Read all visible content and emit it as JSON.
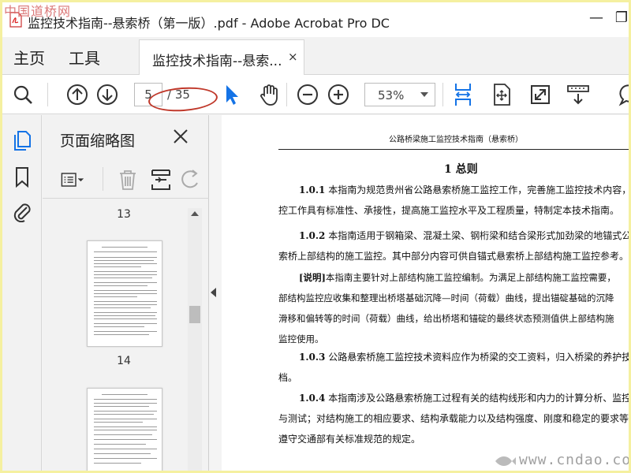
{
  "window": {
    "title": "监控技术指南--悬索桥（第一版）.pdf - Adobe Acrobat Pro DC",
    "watermark_logo": "中国道桥网",
    "minimize_glyph": "—",
    "restore_glyph": "❐"
  },
  "menu": {
    "home": "主页",
    "tools": "工具",
    "doc_tab": "监控技术指南--悬索...",
    "doc_tab_close": "×"
  },
  "toolbar": {
    "page_current": "5",
    "page_total": "/ 35",
    "zoom": "53%",
    "icons": [
      "search-icon",
      "page-up-icon",
      "page-down-icon",
      "select-pointer-icon",
      "hand-icon",
      "zoom-out-icon",
      "zoom-in-icon",
      "fit-width-icon",
      "fit-page-icon",
      "full-screen-icon",
      "scroll-mode-icon",
      "comment-icon"
    ],
    "accent_color": "#1473e6"
  },
  "rail": {
    "icons": [
      "page-thumbnails-icon",
      "bookmark-icon",
      "attachment-icon"
    ]
  },
  "thumbnails": {
    "title": "页面缩略图",
    "close_glyph": "✕",
    "pages": [
      {
        "label": "13"
      },
      {
        "label": "14"
      }
    ]
  },
  "document": {
    "header": "公路桥梁施工监控技术指南（悬索桥）",
    "h1": "1 总则",
    "paragraphs": [
      {
        "num": "1.0.1",
        "lines": [
          "本指南为规范贵州省公路悬索桥施工监控工作，完善施工监控技术内容，使得施工",
          "控工作具有标准性、承接性，提高施工监控水平及工程质量，特制定本技术指南。"
        ]
      },
      {
        "num": "1.0.2",
        "lines": [
          "本指南适用于钢箱梁、混凝土梁、钢桁梁和结合梁形式加劲梁的地锚式公路",
          "索桥上部结构的施工监控。其中部分内容可供自锚式悬索桥上部结构施工监控参考。"
        ]
      },
      {
        "num": "[说明]",
        "lines": [
          "本指南主要针对上部结构施工监控编制。为满足上部结构施工监控需要，",
          "部结构监控应收集和整理出桥塔基础沉降—时间（荷载）曲线，提出锚碇基础的沉降",
          "滑移和偏转等的时间（荷载）曲线，给出桥塔和锚碇的最终状态预测值供上部结构施",
          "监控使用。"
        ]
      },
      {
        "num": "1.0.3",
        "lines": [
          "公路悬索桥施工监控技术资料应作为桥梁的交工资料，归入桥梁的养护技术",
          "档。"
        ]
      },
      {
        "num": "1.0.4",
        "lines": [
          "本指南涉及公路悬索桥施工过程有关的结构线形和内力的计算分析、监控测",
          "与测试；对结构施工的相应要求、结构承载能力以及结构强度、刚度和稳定的要求等",
          "遵守交通部有关标准规范的规定。"
        ]
      }
    ]
  },
  "site_watermark": "www.cndao.com"
}
